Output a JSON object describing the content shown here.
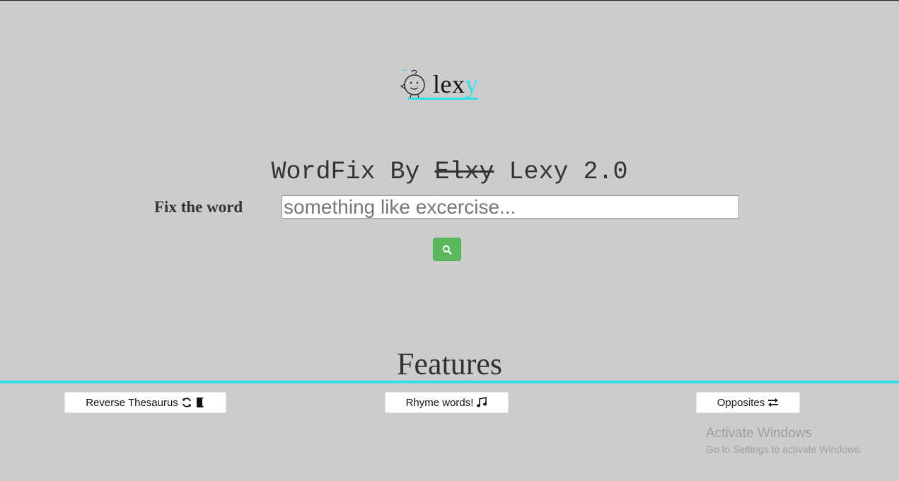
{
  "logo": {
    "text_main": "lex",
    "text_accent": "y",
    "icon": "baby-face-icon",
    "accent_color": "#2fe0e8"
  },
  "heading": {
    "part1": "WordFix By ",
    "struck": "Elxy",
    "part2": " Lexy 2.0"
  },
  "form": {
    "label": "Fix the word",
    "input_placeholder": "something like excercise...",
    "input_value": "",
    "search_icon": "search-icon",
    "button_color": "#5cb85c"
  },
  "features": {
    "title": "Features",
    "buttons": [
      {
        "label": "Reverse Thesaurus",
        "icons": [
          "refresh-icon",
          "book-icon"
        ]
      },
      {
        "label": "Rhyme words!",
        "icons": [
          "music-note-icon"
        ]
      },
      {
        "label": "Opposites",
        "icons": [
          "swap-arrows-icon"
        ]
      }
    ]
  },
  "watermark": {
    "title": "Activate Windows",
    "subtitle": "Go to Settings to activate Windows."
  }
}
